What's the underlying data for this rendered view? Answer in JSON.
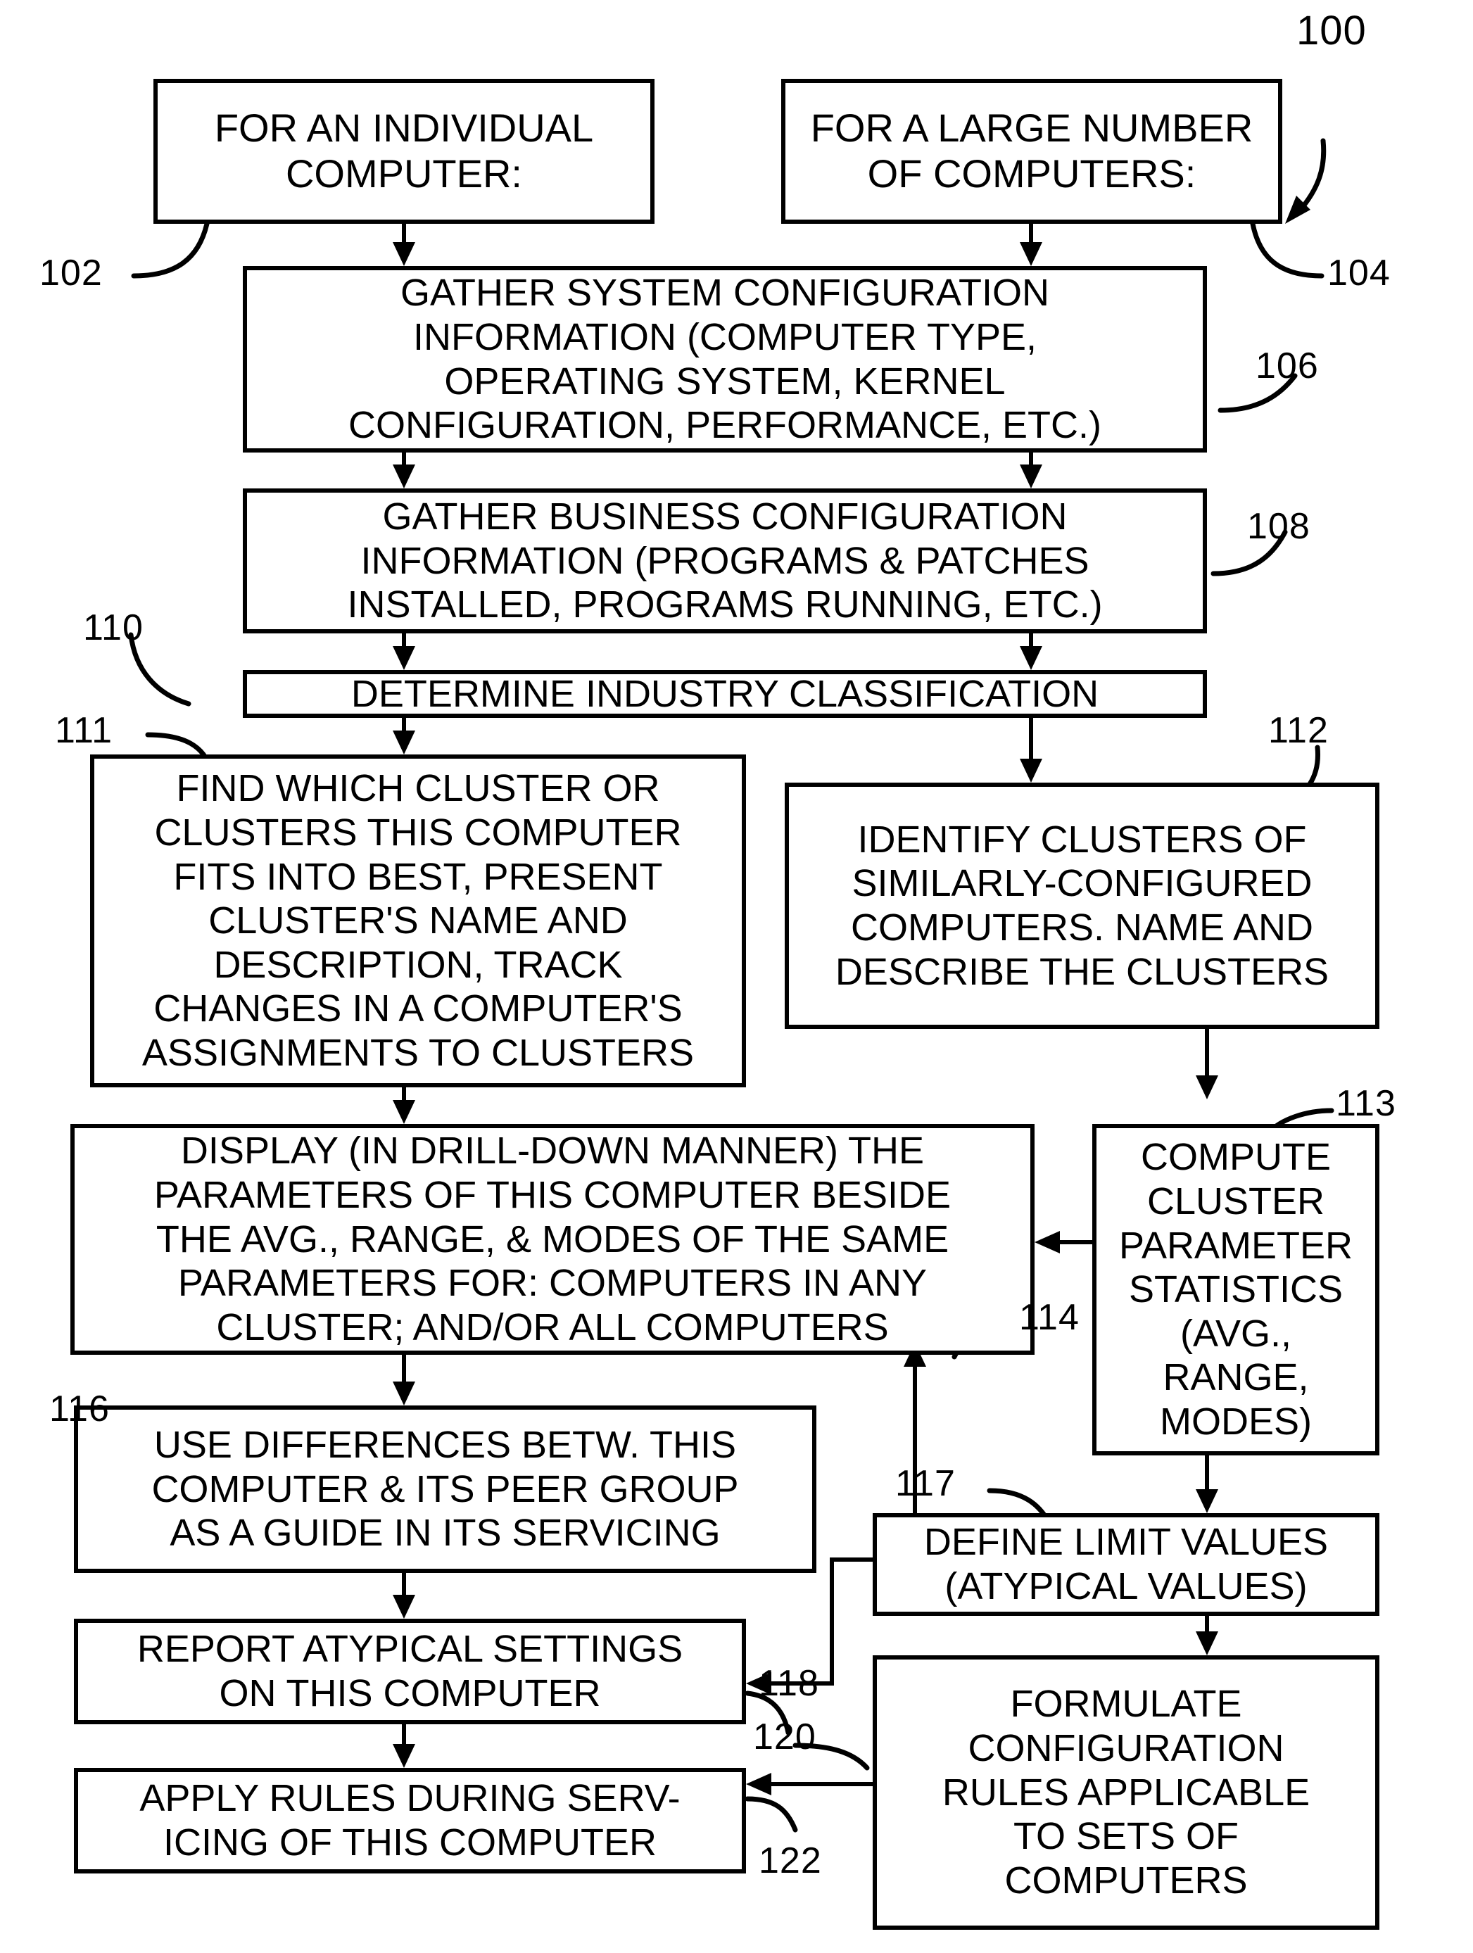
{
  "figure": {
    "figure_number": "100",
    "boxes": [
      {
        "id": "102",
        "label": "FOR AN INDIVIDUAL\nCOMPUTER:"
      },
      {
        "id": "104",
        "label": "FOR A LARGE NUMBER\nOF COMPUTERS:"
      },
      {
        "id": "106",
        "label": "GATHER SYSTEM CONFIGURATION\nINFORMATION (COMPUTER TYPE,\nOPERATING SYSTEM, KERNEL\nCONFIGURATION, PERFORMANCE, ETC.)"
      },
      {
        "id": "108",
        "label": "GATHER BUSINESS CONFIGURATION\nINFORMATION (PROGRAMS & PATCHES\nINSTALLED, PROGRAMS RUNNING, ETC.)"
      },
      {
        "id": "110",
        "label": "DETERMINE INDUSTRY CLASSIFICATION"
      },
      {
        "id": "111",
        "label": "FIND WHICH CLUSTER OR\nCLUSTERS THIS COMPUTER\nFITS INTO BEST, PRESENT\nCLUSTER'S NAME AND\nDESCRIPTION, TRACK\nCHANGES IN A COMPUTER'S\nASSIGNMENTS TO CLUSTERS"
      },
      {
        "id": "112",
        "label": "IDENTIFY CLUSTERS OF\nSIMILARLY-CONFIGURED\nCOMPUTERS.  NAME AND\nDESCRIBE THE CLUSTERS"
      },
      {
        "id": "113",
        "label": "COMPUTE\nCLUSTER\nPARAMETER\nSTATISTICS\n(AVG.,\nRANGE,\nMODES)"
      },
      {
        "id": "114",
        "label": "DISPLAY (IN DRILL-DOWN MANNER) THE\nPARAMETERS OF THIS COMPUTER BESIDE\nTHE AVG., RANGE, & MODES OF THE SAME\nPARAMETERS FOR:  COMPUTERS IN ANY\nCLUSTER; AND/OR ALL COMPUTERS"
      },
      {
        "id": "116",
        "label": "USE DIFFERENCES BETW. THIS\nCOMPUTER & ITS PEER GROUP\nAS A GUIDE IN ITS SERVICING"
      },
      {
        "id": "117",
        "label": "DEFINE LIMIT VALUES\n(ATYPICAL VALUES)"
      },
      {
        "id": "118",
        "label": "REPORT ATYPICAL SETTINGS\nON THIS COMPUTER"
      },
      {
        "id": "120",
        "label": "FORMULATE\nCONFIGURATION\nRULES APPLICABLE\nTO SETS OF\nCOMPUTERS"
      },
      {
        "id": "122",
        "label": "APPLY RULES DURING SERV-\nICING OF THIS COMPUTER"
      }
    ],
    "reference_numerals": [
      "100",
      "102",
      "104",
      "106",
      "108",
      "110",
      "111",
      "112",
      "113",
      "114",
      "116",
      "117",
      "118",
      "120",
      "122"
    ],
    "colors": {
      "ink": "#000000",
      "paper": "#ffffff"
    }
  }
}
